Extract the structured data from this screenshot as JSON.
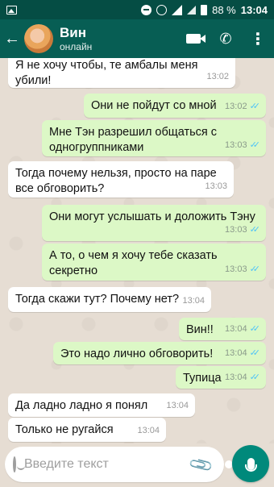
{
  "status_bar": {
    "battery_percent": "88 %",
    "time": "13:04"
  },
  "header": {
    "back_icon": "arrow-left",
    "contact_name": "Вин",
    "contact_status": "онлайн",
    "icons": [
      "video-call-icon",
      "phone-icon",
      "more-vert-icon"
    ]
  },
  "messages": [
    {
      "dir": "in",
      "text": "Я не хочу чтобы, те амбалы меня убили!",
      "time": "13:02"
    },
    {
      "dir": "out",
      "text": "Они не пойдут со мной",
      "time": "13:02",
      "read": true
    },
    {
      "dir": "out",
      "text": "Мне Тэн разрешил общаться с одногруппниками",
      "time": "13:03",
      "read": true
    },
    {
      "dir": "in",
      "text": "Тогда почему нельзя, просто на паре все обговорить?",
      "time": "13:03"
    },
    {
      "dir": "out",
      "text": "Они могут услышать и доложить Тэну",
      "time": "13:03",
      "read": true
    },
    {
      "dir": "out",
      "text": "А то, о чем я хочу тебе сказать секретно",
      "time": "13:03",
      "read": true
    },
    {
      "dir": "in",
      "text": "Тогда  скажи тут? Почему нет?",
      "time": "13:04"
    },
    {
      "dir": "out",
      "text": "Вин!!",
      "time": "13:04",
      "read": true
    },
    {
      "dir": "out",
      "text": "Это надо лично обговорить!",
      "time": "13:04",
      "read": true
    },
    {
      "dir": "out",
      "text": "Тупица",
      "time": "13:04",
      "read": true
    },
    {
      "dir": "in",
      "text": "Да ладно ладно я понял",
      "time": "13:04"
    },
    {
      "dir": "in",
      "text": "Только не ругайся",
      "time": "13:04"
    }
  ],
  "input": {
    "placeholder": "Введите текст",
    "icons": [
      "emoji-icon",
      "attach-icon",
      "camera-icon",
      "mic-icon"
    ]
  },
  "colors": {
    "header": "#075e54",
    "status_bar": "#054d44",
    "outgoing_bubble": "#dcf8c6",
    "incoming_bubble": "#ffffff",
    "read_ticks": "#4fc3f7",
    "mic_button": "#00897b"
  }
}
